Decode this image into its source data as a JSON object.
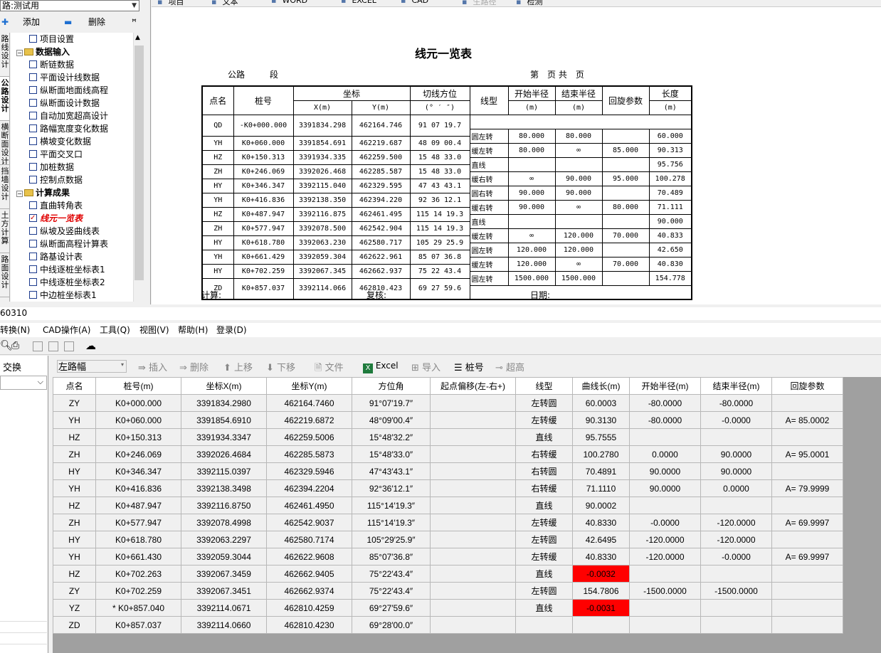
{
  "left_panel": {
    "road_label": "路:",
    "road_value": "测试用",
    "add": "添加",
    "del": "删除",
    "pin": "ᵱ",
    "vtabs": [
      "路线设计",
      "公路设计",
      "横断面设计",
      "挡墙设计",
      "土方计算",
      "路面设计"
    ],
    "tree": [
      {
        "label": "项目设置",
        "level": 1,
        "kind": "cb"
      },
      {
        "label": "数据输入",
        "level": 0,
        "kind": "folder"
      },
      {
        "label": "断链数据",
        "level": 1,
        "kind": "cb"
      },
      {
        "label": "平面设计线数据",
        "level": 1,
        "kind": "cb"
      },
      {
        "label": "纵断面地面线高程",
        "level": 1,
        "kind": "cb"
      },
      {
        "label": "纵断面设计数据",
        "level": 1,
        "kind": "cb"
      },
      {
        "label": "自动加宽超高设计",
        "level": 1,
        "kind": "cb"
      },
      {
        "label": "路幅宽度变化数据",
        "level": 1,
        "kind": "cb"
      },
      {
        "label": "横坡变化数据",
        "level": 1,
        "kind": "cb"
      },
      {
        "label": "平面交叉口",
        "level": 1,
        "kind": "cb"
      },
      {
        "label": "加桩数据",
        "level": 1,
        "kind": "cb"
      },
      {
        "label": "控制点数据",
        "level": 1,
        "kind": "cb"
      },
      {
        "label": "计算成果",
        "level": 0,
        "kind": "folder"
      },
      {
        "label": "直曲转角表",
        "level": 1,
        "kind": "cb"
      },
      {
        "label": "线元一览表",
        "level": 1,
        "kind": "cbon"
      },
      {
        "label": "纵坡及竖曲线表",
        "level": 1,
        "kind": "cb"
      },
      {
        "label": "纵断面高程计算表",
        "level": 1,
        "kind": "cb"
      },
      {
        "label": "路基设计表",
        "level": 1,
        "kind": "cb"
      },
      {
        "label": "中线逐桩坐标表1",
        "level": 1,
        "kind": "cb"
      },
      {
        "label": "中线逐桩坐标表2",
        "level": 1,
        "kind": "cb"
      },
      {
        "label": "中边桩坐标表1",
        "level": 1,
        "kind": "cb"
      }
    ]
  },
  "report_toolbar": [
    "项目",
    "文本",
    "WORD",
    "EXCEL",
    "CAD",
    "生路径",
    "检测"
  ],
  "report": {
    "title": "线元一览表",
    "road": "公路",
    "section": "段",
    "page": "第　页 共　页",
    "headers": {
      "point": "点名",
      "station": "桩号",
      "coord": "坐标",
      "x": "X(m)",
      "y": "Y(m)",
      "azimuth": "切线方位",
      "azimuth_unit": "(° ′ ″)",
      "type": "线型",
      "r1": "开始半径",
      "r1_unit": "(m)",
      "r2": "结束半径",
      "r2_unit": "(m)",
      "a": "回旋参数",
      "len": "长度",
      "len_unit": "(m)"
    },
    "points": [
      [
        "QD",
        "-K0+000.000",
        "3391834.298",
        "462164.746",
        "91 07 19.7"
      ],
      [
        "YH",
        "K0+060.000",
        "3391854.691",
        "462219.687",
        "48 09 00.4"
      ],
      [
        "HZ",
        "K0+150.313",
        "3391934.335",
        "462259.500",
        "15 48 33.0"
      ],
      [
        "ZH",
        "K0+246.069",
        "3392026.468",
        "462285.587",
        "15 48 33.0"
      ],
      [
        "HY",
        "K0+346.347",
        "3392115.040",
        "462329.595",
        "47 43 43.1"
      ],
      [
        "YH",
        "K0+416.836",
        "3392138.350",
        "462394.220",
        "92 36 12.1"
      ],
      [
        "HZ",
        "K0+487.947",
        "3392116.875",
        "462461.495",
        "115 14 19.3"
      ],
      [
        "ZH",
        "K0+577.947",
        "3392078.500",
        "462542.904",
        "115 14 19.3"
      ],
      [
        "HY",
        "K0+618.780",
        "3392063.230",
        "462580.717",
        "105 29 25.9"
      ],
      [
        "YH",
        "K0+661.429",
        "3392059.304",
        "462622.961",
        "85 07 36.8"
      ],
      [
        "HY",
        "K0+702.259",
        "3392067.345",
        "462662.937",
        "75 22 43.4"
      ],
      [
        "ZD",
        "K0+857.037",
        "3392114.066",
        "462810.423",
        "69 27 59.6"
      ]
    ],
    "elements": [
      [
        "圆左转",
        "80.000",
        "80.000",
        "",
        "60.000"
      ],
      [
        "缓左转",
        "80.000",
        "∞",
        "85.000",
        "90.313"
      ],
      [
        "直线",
        "",
        "",
        "",
        "95.756"
      ],
      [
        "缓右转",
        "∞",
        "90.000",
        "95.000",
        "100.278"
      ],
      [
        "圆右转",
        "90.000",
        "90.000",
        "",
        "70.489"
      ],
      [
        "缓右转",
        "90.000",
        "∞",
        "80.000",
        "71.111"
      ],
      [
        "直线",
        "",
        "",
        "",
        "90.000"
      ],
      [
        "缓左转",
        "∞",
        "120.000",
        "70.000",
        "40.833"
      ],
      [
        "圆左转",
        "120.000",
        "120.000",
        "",
        "42.650"
      ],
      [
        "缓左转",
        "120.000",
        "∞",
        "70.000",
        "40.830"
      ],
      [
        "圆左转",
        "1500.000",
        "1500.000",
        "",
        "154.778"
      ]
    ],
    "footer": {
      "calc": "计算:",
      "check": "复核:",
      "date": "日期:"
    }
  },
  "app": {
    "status_title": "60310",
    "menu": [
      "转换(N)",
      "CAD操作(A)",
      "工具(Q)",
      "视图(V)",
      "帮助(H)",
      "登录(D)"
    ],
    "left_pane_label": "交换",
    "grid_toolbar": {
      "side": "左路幅",
      "insert": "插入",
      "delete": "删除",
      "up": "上移",
      "down": "下移",
      "file": "文件",
      "excel": "Excel",
      "import": "导入",
      "station": "桩号",
      "elev": "超高"
    },
    "grid_headers": [
      "点名",
      "桩号(m)",
      "坐标X(m)",
      "坐标Y(m)",
      "方位角",
      "起点偏移(左-右+)",
      "线型",
      "曲线长(m)",
      "开始半径(m)",
      "结束半径(m)",
      "回旋参数"
    ],
    "grid_rows": [
      [
        "ZY",
        "K0+000.000",
        "3391834.2980",
        "462164.7460",
        "91°07′19.7″",
        "",
        "左转圆",
        "60.0003",
        "-80.0000",
        "-80.0000",
        ""
      ],
      [
        "YH",
        "K0+060.000",
        "3391854.6910",
        "462219.6872",
        "48°09′00.4″",
        "",
        "左转缓",
        "90.3130",
        "-80.0000",
        "-0.0000",
        "A= 85.0002"
      ],
      [
        "HZ",
        "K0+150.313",
        "3391934.3347",
        "462259.5006",
        "15°48′32.2″",
        "",
        "直线",
        "95.7555",
        "",
        "",
        ""
      ],
      [
        "ZH",
        "K0+246.069",
        "3392026.4684",
        "462285.5873",
        "15°48′33.0″",
        "",
        "右转缓",
        "100.2780",
        "0.0000",
        "90.0000",
        "A= 95.0001"
      ],
      [
        "HY",
        "K0+346.347",
        "3392115.0397",
        "462329.5946",
        "47°43′43.1″",
        "",
        "右转圆",
        "70.4891",
        "90.0000",
        "90.0000",
        ""
      ],
      [
        "YH",
        "K0+416.836",
        "3392138.3498",
        "462394.2204",
        "92°36′12.1″",
        "",
        "右转缓",
        "71.1110",
        "90.0000",
        "0.0000",
        "A= 79.9999"
      ],
      [
        "HZ",
        "K0+487.947",
        "3392116.8750",
        "462461.4950",
        "115°14′19.3″",
        "",
        "直线",
        "90.0002",
        "",
        "",
        ""
      ],
      [
        "ZH",
        "K0+577.947",
        "3392078.4998",
        "462542.9037",
        "115°14′19.3″",
        "",
        "左转缓",
        "40.8330",
        "-0.0000",
        "-120.0000",
        "A= 69.9997"
      ],
      [
        "HY",
        "K0+618.780",
        "3392063.2297",
        "462580.7174",
        "105°29′25.9″",
        "",
        "左转圆",
        "42.6495",
        "-120.0000",
        "-120.0000",
        ""
      ],
      [
        "YH",
        "K0+661.430",
        "3392059.3044",
        "462622.9608",
        "85°07′36.8″",
        "",
        "左转缓",
        "40.8330",
        "-120.0000",
        "-0.0000",
        "A= 69.9997"
      ],
      [
        "HZ",
        "K0+702.263",
        "3392067.3459",
        "462662.9405",
        "75°22′43.4″",
        "",
        "直线",
        "-0.0032",
        "",
        "",
        ""
      ],
      [
        "ZY",
        "K0+702.259",
        "3392067.3451",
        "462662.9374",
        "75°22′43.4″",
        "",
        "左转圆",
        "154.7806",
        "-1500.0000",
        "-1500.0000",
        ""
      ],
      [
        "YZ",
        "* K0+857.040",
        "3392114.0671",
        "462810.4259",
        "69°27′59.6″",
        "",
        "直线",
        "-0.0031",
        "",
        "",
        ""
      ],
      [
        "ZD",
        "K0+857.037",
        "3392114.0660",
        "462810.4230",
        "69°28′00.0″",
        "",
        "",
        "",
        "",
        "",
        ""
      ]
    ],
    "red_cells": [
      [
        10,
        7
      ],
      [
        12,
        7
      ]
    ]
  }
}
